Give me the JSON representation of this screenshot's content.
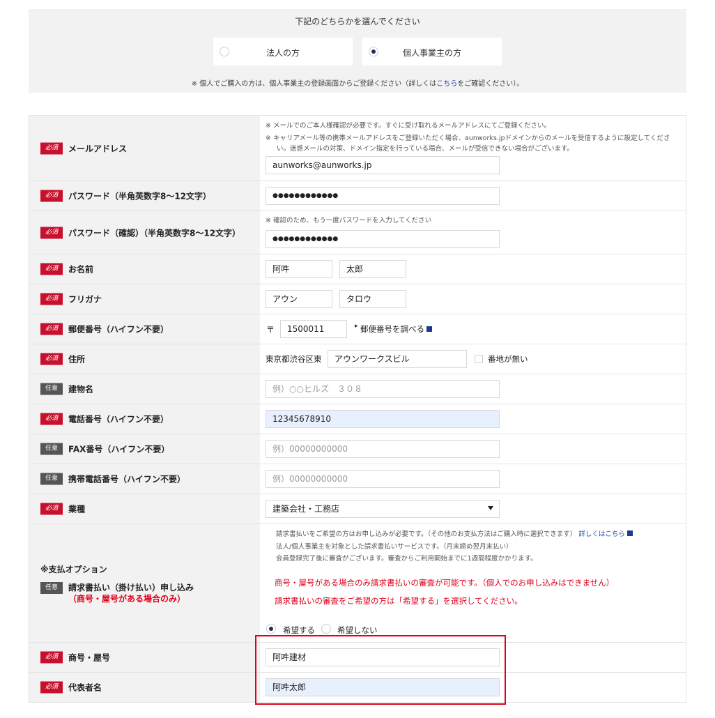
{
  "customer_type": {
    "prompt": "下記のどちらかを選んでください",
    "options": [
      {
        "label": "法人の方",
        "selected": false
      },
      {
        "label": "個人事業主の方",
        "selected": true
      }
    ],
    "note_prefix": "※ 個人でご購入の方は、個人事業主の登録画面からご登録ください（詳しくは",
    "note_link": "こちら",
    "note_suffix": "をご確認ください）。"
  },
  "badges": {
    "required": "必須",
    "optional": "任意"
  },
  "fields": {
    "email": {
      "label": "メールアドレス",
      "note1": "※ メールでのご本人様確認が必要です。すぐに受け取れるメールアドレスにてご登録ください。",
      "note2": "※ キャリアメール等の携帯メールアドレスをご登録いただく場合、aunworks.jpドメインからのメールを受信するように設定してくださ",
      "note3": "い。迷惑メールの対策、ドメイン指定を行っている場合、メールが受信できない場合がございます。",
      "value": "aunworks@aunworks.jp"
    },
    "password": {
      "label": "パスワード（半角英数字8～12文字）",
      "value": "●●●●●●●●●●●●"
    },
    "password_confirm": {
      "label": "パスワード（確認）（半角英数字8～12文字）",
      "note": "※ 確認のため、もう一度パスワードを入力してください",
      "value": "●●●●●●●●●●●●"
    },
    "name": {
      "label": "お名前",
      "last": "阿吽",
      "first": "太郎"
    },
    "furigana": {
      "label": "フリガナ",
      "last": "アウン",
      "first": "タロウ"
    },
    "postal": {
      "label": "郵便番号（ハイフン不要）",
      "mark": "〒",
      "value": "1500011",
      "lookup": "郵便番号を調べる"
    },
    "address": {
      "label": "住所",
      "prefix": "東京都渋谷区東",
      "value": "アウンワークスビル",
      "no_number": "番地が無い"
    },
    "building": {
      "label": "建物名",
      "placeholder": "例）○○ヒルズ　３０８"
    },
    "phone": {
      "label": "電話番号（ハイフン不要）",
      "value": "12345678910"
    },
    "fax": {
      "label": "FAX番号（ハイフン不要）",
      "placeholder": "例）00000000000"
    },
    "mobile": {
      "label": "携帯電話番号（ハイフン不要）",
      "placeholder": "例）00000000000"
    },
    "industry": {
      "label": "業種",
      "value": "建築会社・工務店"
    },
    "payment": {
      "section_title": "※支払オプション",
      "label": "請求書払い（掛け払い）申し込み",
      "sublabel": "（商号・屋号がある場合のみ）",
      "info1": "請求書払いをご希望の方はお申し込みが必要です。（その他のお支払方法はご購入時に選択できます）",
      "info1_link": "詳しくはこちら",
      "info2": "法人/個人事業主を対象とした請求書払いサービスです。（月末締め翌月末払い）",
      "info3": "会員登録完了後に審査がございます。審査からご利用開始までに1週間程度かかります。",
      "warn1": "商号・屋号がある場合のみ請求書払いの審査が可能です。（個人でのお申し込みはできません）",
      "warn2": "請求書払いの審査をご希望の方は「希望する」を選択してください。",
      "opt_yes": "希望する",
      "opt_no": "希望しない"
    },
    "trade_name": {
      "label": "商号・屋号",
      "value": "阿吽建材"
    },
    "representative": {
      "label": "代表者名",
      "value": "阿吽太郎"
    }
  },
  "colors": {
    "required_badge": "#c8102e",
    "optional_badge": "#555555",
    "highlight": "#e0001b",
    "link": "#2348b4"
  }
}
